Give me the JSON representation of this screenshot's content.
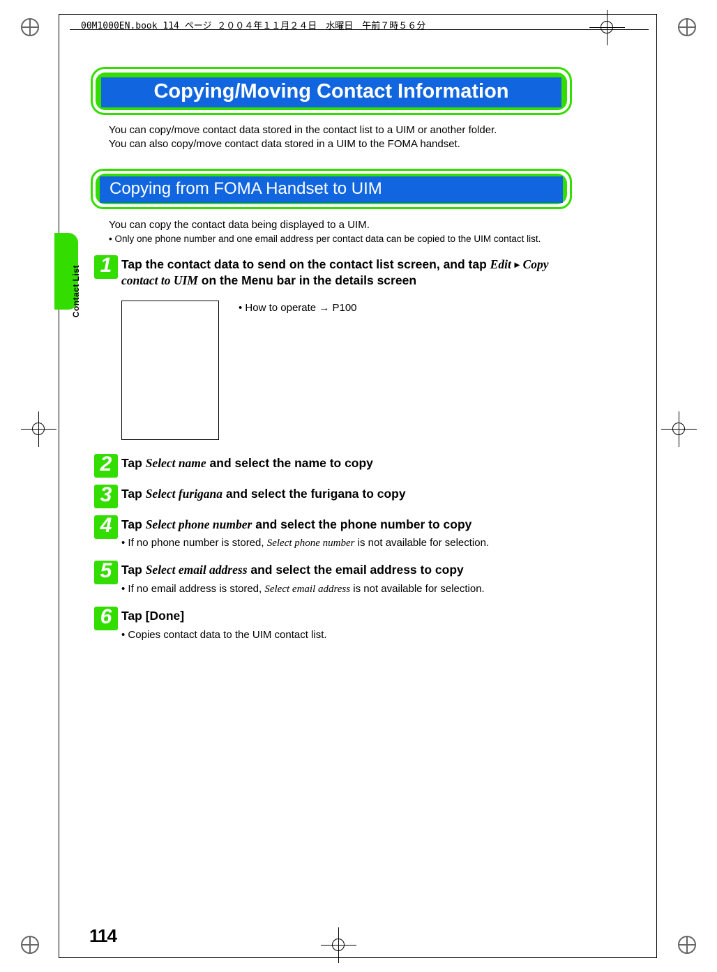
{
  "header": "00M1000EN.book  114 ページ  ２００４年１１月２４日　水曜日　午前７時５６分",
  "side_label": "Contact List",
  "page_number": "114",
  "main_title": "Copying/Moving Contact Information",
  "intro_line1": "You can copy/move contact data stored in the contact list to a UIM or another folder.",
  "intro_line2": "You can also copy/move contact data stored in a UIM to the FOMA handset.",
  "sub_title": "Copying from FOMA Handset to UIM",
  "sub_intro": "You can copy the contact data being displayed to a UIM.",
  "sub_note": "Only one phone number and one email address per contact data can be copied to the UIM contact list.",
  "how_to_operate": "How to operate → P100",
  "steps": {
    "s1": {
      "num": "1",
      "pre": "Tap the contact data to send on the contact list screen, and tap ",
      "edit": "Edit",
      "copy_to_uim": "Copy contact to UIM",
      "post": " on the Menu bar in the details screen"
    },
    "s2": {
      "num": "2",
      "pre": "Tap ",
      "select_name": "Select name",
      "post": " and select the name to copy"
    },
    "s3": {
      "num": "3",
      "pre": "Tap ",
      "select_furigana": "Select furigana",
      "post": " and select the furigana to copy"
    },
    "s4": {
      "num": "4",
      "pre": "Tap ",
      "select_phone": "Select phone number",
      "post": " and select the phone number to copy",
      "note_pre": "If no phone number is stored, ",
      "note_ital": "Select phone number",
      "note_post": " is not available for selection."
    },
    "s5": {
      "num": "5",
      "pre": "Tap ",
      "select_email": "Select email address",
      "post": " and select the email address to copy",
      "note_pre": "If no email address is stored, ",
      "note_ital": "Select email address",
      "note_post": " is not available for selection."
    },
    "s6": {
      "num": "6",
      "title": "Tap [Done]",
      "note": "Copies contact data to the UIM contact list."
    }
  }
}
